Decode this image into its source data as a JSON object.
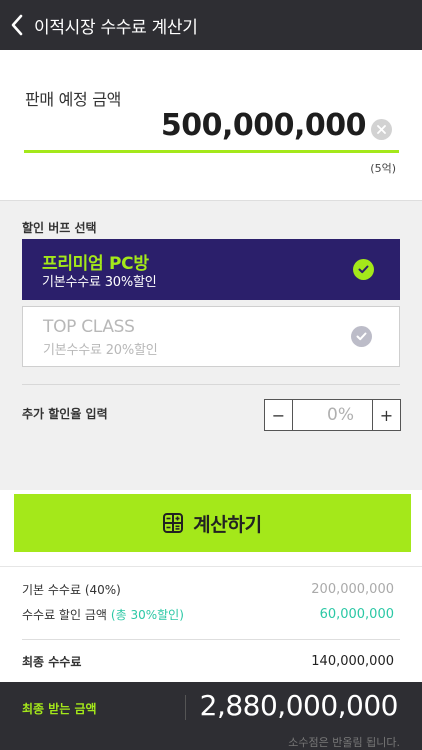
{
  "header": {
    "title": "이적시장 수수료 계산기"
  },
  "amount": {
    "label": "판매 예정 금액",
    "value": "500,000,000",
    "hint": "(5억)"
  },
  "buff": {
    "title": "할인 버프 선택",
    "options": [
      {
        "name": "프리미엄 PC방",
        "desc": "기본수수료 30%할인",
        "selected": true
      },
      {
        "name": "TOP CLASS",
        "desc": "기본수수료 20%할인",
        "selected": false
      }
    ]
  },
  "discount": {
    "label": "추가 할인율 입력",
    "minus": "−",
    "value": "0%",
    "plus": "+"
  },
  "calc_button": {
    "label": "계산하기"
  },
  "result": {
    "base_label": "기본 수수료 (40%)",
    "base_value": "200,000,000",
    "discount_label": "수수료 할인 금액",
    "discount_note": "(총 30%할인)",
    "discount_value": "60,000,000",
    "final_label": "최종 수수료",
    "final_value": "140,000,000"
  },
  "footer": {
    "label": "최종 받는 금액",
    "value": "2,880,000,000",
    "note": "소수점은 반올림 됩니다."
  },
  "colors": {
    "accent": "#a4e81a",
    "header": "#2e2e33",
    "selected_card": "#2b1f6b",
    "discount_text": "#2bc8a5"
  }
}
